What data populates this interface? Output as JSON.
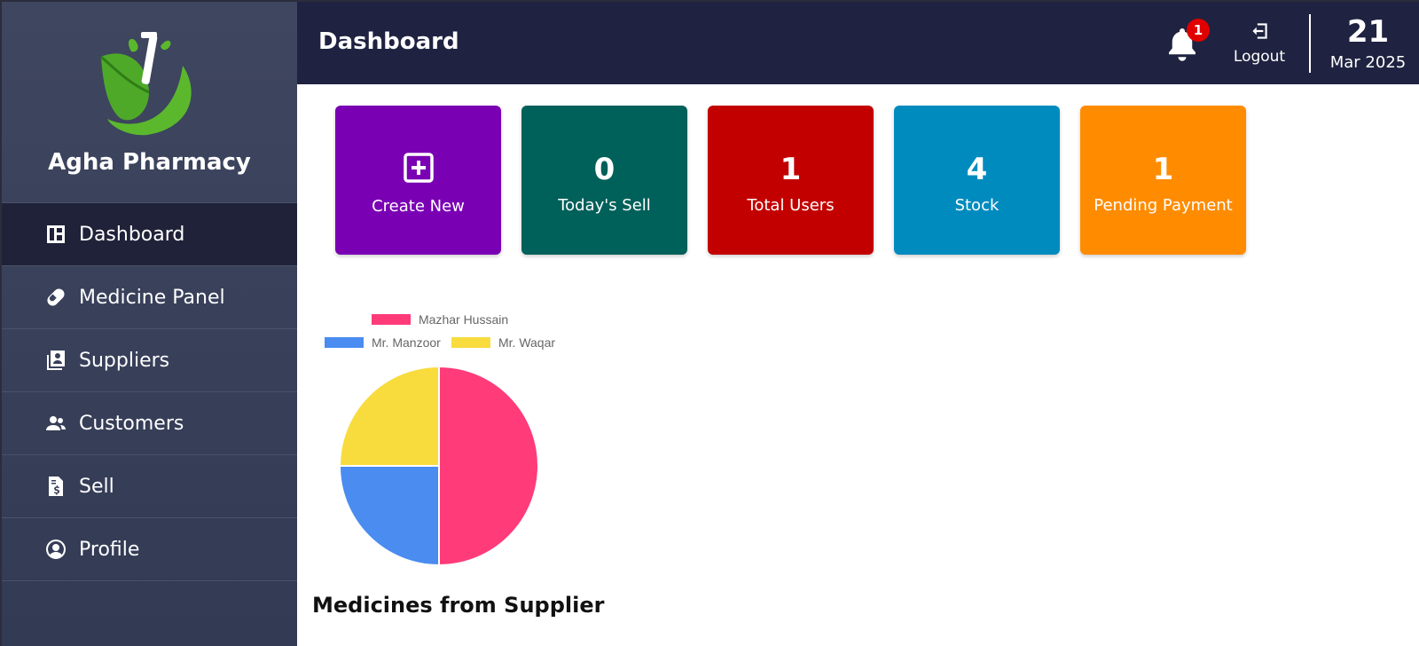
{
  "app": {
    "name": "Agha Pharmacy"
  },
  "sidebar": {
    "items": [
      {
        "label": "Dashboard",
        "icon": "dashboard-icon",
        "active": true
      },
      {
        "label": "Medicine Panel",
        "icon": "pill-icon"
      },
      {
        "label": "Suppliers",
        "icon": "contact-book-icon"
      },
      {
        "label": "Customers",
        "icon": "users-icon"
      },
      {
        "label": "Sell",
        "icon": "invoice-dollar-icon"
      },
      {
        "label": "Profile",
        "icon": "user-circle-icon"
      }
    ]
  },
  "header": {
    "title": "Dashboard",
    "notification_count": "1",
    "logout_label": "Logout",
    "date_day": "21",
    "date_month": "Mar 2025"
  },
  "cards": [
    {
      "label": "Create New",
      "value": "",
      "icon": "plus-square-icon",
      "color": "#7a00b4"
    },
    {
      "label": "Today's Sell",
      "value": "0",
      "color": "#00605a"
    },
    {
      "label": "Total Users",
      "value": "1",
      "color": "#c30000"
    },
    {
      "label": "Stock",
      "value": "4",
      "color": "#008bbf"
    },
    {
      "label": "Pending Payment",
      "value": "1",
      "color": "#ff8c00"
    }
  ],
  "chart_caption": "Medicines from Supplier",
  "chart_data": {
    "type": "pie",
    "categories": [
      "Mazhar Hussain",
      "Mr. Manzoor",
      "Mr. Waqar"
    ],
    "values": [
      2,
      1,
      1
    ],
    "colors": [
      "#ff3b7a",
      "#4a8cf0",
      "#f8dc3e"
    ],
    "legend": "top"
  }
}
